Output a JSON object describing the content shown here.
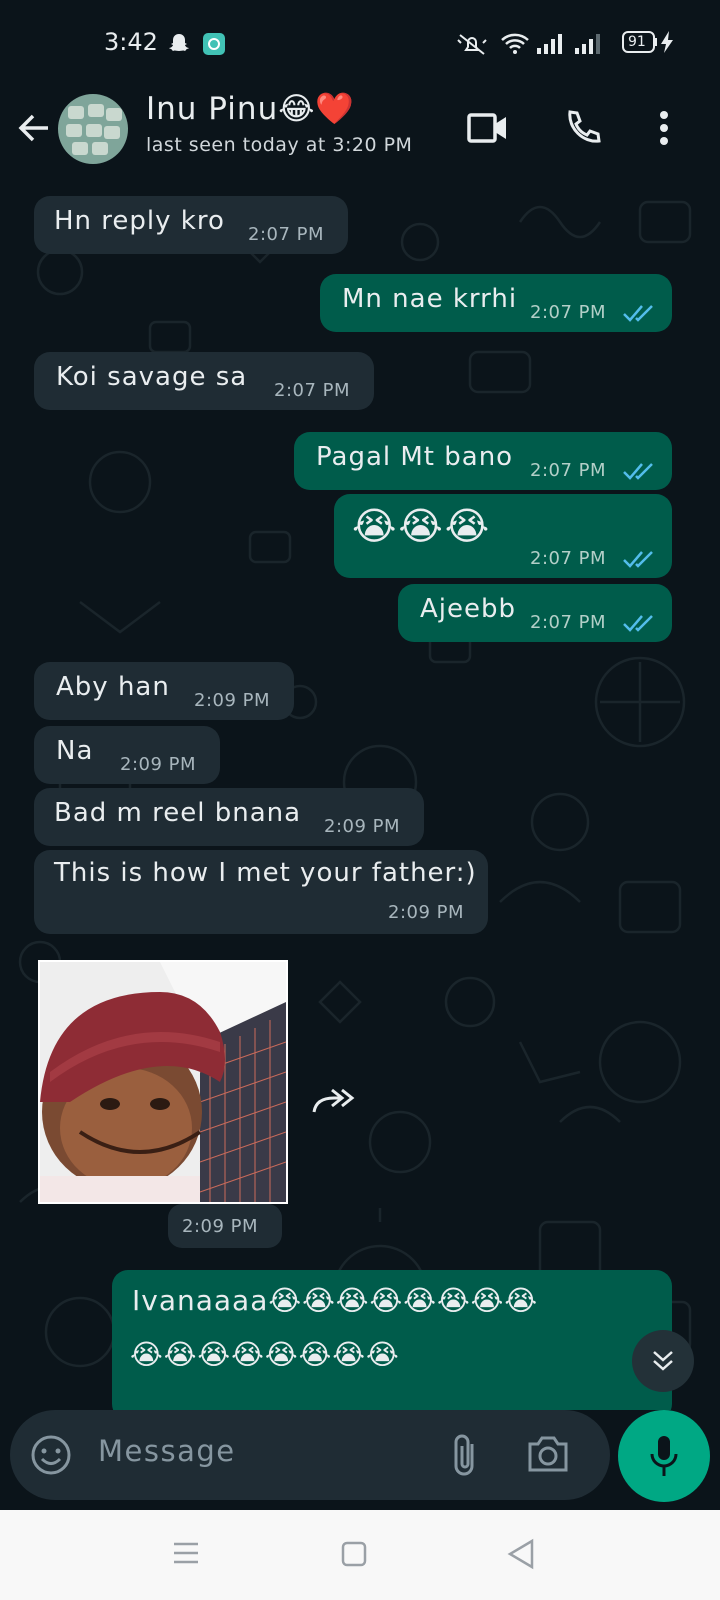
{
  "status_bar": {
    "time": "3:42",
    "battery": "91",
    "icons": [
      "snapchat-icon",
      "app-notification-icon",
      "mute-icon",
      "wifi-icon",
      "signal-icon",
      "signal-icon-2",
      "battery-icon",
      "charging-icon"
    ]
  },
  "header": {
    "contact_name": "Inu Pinu😂❤️",
    "last_seen": "last seen today at 3:20 PM",
    "icons": [
      "back-arrow-icon",
      "video-call-icon",
      "voice-call-icon",
      "more-options-icon"
    ]
  },
  "messages": [
    {
      "dir": "in",
      "text": "Hn reply kro",
      "time": "2:07 PM"
    },
    {
      "dir": "out",
      "text": "Mn nae krrhi",
      "time": "2:07 PM",
      "read": true
    },
    {
      "dir": "in",
      "text": "Koi savage sa",
      "time": "2:07 PM"
    },
    {
      "dir": "out",
      "text": "Pagal Mt bano",
      "time": "2:07 PM",
      "read": true
    },
    {
      "dir": "out",
      "text": "😭😭😭",
      "time": "2:07 PM",
      "read": true
    },
    {
      "dir": "out",
      "text": "Ajeebb",
      "time": "2:07 PM",
      "read": true
    },
    {
      "dir": "in",
      "text": "Aby han",
      "time": "2:09 PM"
    },
    {
      "dir": "in",
      "text": "Na",
      "time": "2:09 PM"
    },
    {
      "dir": "in",
      "text": "Bad m reel bnana",
      "time": "2:09 PM"
    },
    {
      "dir": "in",
      "text": "This is how I met your father:)",
      "time": "2:09 PM"
    },
    {
      "dir": "in",
      "type": "image",
      "time": "2:09 PM"
    },
    {
      "dir": "out",
      "text_line1": "Ivanaaaa😭😭😭😭😭😭😭😭",
      "text_line2": "😭😭😭😭😭😭😭😭"
    }
  ],
  "composer": {
    "placeholder": "Message",
    "icons": [
      "emoji-icon",
      "attach-icon",
      "camera-icon",
      "mic-icon"
    ]
  },
  "nav": {
    "icons": [
      "menu-icon",
      "home-icon",
      "back-icon"
    ]
  },
  "colors": {
    "background": "#0b141a",
    "incoming_bubble": "#1f2c34",
    "outgoing_bubble": "#005c4b",
    "accent": "#00a884",
    "read_ticks": "#53bdeb"
  }
}
